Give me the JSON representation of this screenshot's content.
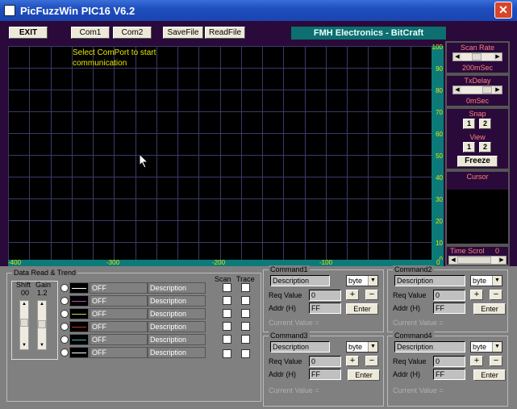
{
  "window": {
    "title": "PicFuzzWin PIC16 V6.2",
    "close": "✕"
  },
  "toolbar": {
    "exit": "EXIT",
    "com1": "Com1",
    "com2": "Com2",
    "savefile": "SaveFile",
    "readfile": "ReadFile",
    "brand": "FMH Electronics - BitCraft"
  },
  "plot": {
    "message_line1": "Select ComPort to start",
    "message_line2": "communication",
    "y_ticks": [
      "100",
      "90",
      "80",
      "70",
      "60",
      "50",
      "40",
      "30",
      "20",
      "10",
      "0"
    ],
    "x_ticks": [
      "-400",
      "-300",
      "-200",
      "-100",
      "0"
    ]
  },
  "right": {
    "scan_rate_label": "Scan Rate",
    "scan_rate_value": "200mSec",
    "txdelay_label": "TxDelay",
    "txdelay_value": "0mSec",
    "snap_label": "Snap",
    "view_label": "View",
    "btn1": "1",
    "btn2": "2",
    "freeze": "Freeze",
    "cursor_label": "Cursor",
    "time_scroll_label": "Time Scrol",
    "time_scroll_value": "0"
  },
  "data_frame": {
    "title": "Data Read & Trend",
    "shift_label": "Shift",
    "gain_label": "Gain",
    "shift_value": "00",
    "gain_value": "1.2",
    "scan_label": "Scan",
    "trace_label": "Trace",
    "channels": [
      {
        "state": "OFF",
        "desc": "Description",
        "color": "#000000"
      },
      {
        "state": "OFF",
        "desc": "Description",
        "color": "#c040c0"
      },
      {
        "state": "OFF",
        "desc": "Description",
        "color": "#d0d060"
      },
      {
        "state": "OFF",
        "desc": "Description",
        "color": "#c03030"
      },
      {
        "state": "OFF",
        "desc": "Description",
        "color": "#40c0c0"
      },
      {
        "state": "OFF",
        "desc": "Description",
        "color": "#ffffff"
      }
    ]
  },
  "commands": [
    {
      "title": "Command1",
      "desc": "Description",
      "type": "byte",
      "req_label": "Req Value",
      "req_value": "0",
      "addr_label": "Addr (H)",
      "addr_value": "FF",
      "enter": "Enter",
      "current": "Current Value ="
    },
    {
      "title": "Command2",
      "desc": "Description",
      "type": "byte",
      "req_label": "Req Value",
      "req_value": "0",
      "addr_label": "Addr (H)",
      "addr_value": "FF",
      "enter": "Enter",
      "current": "Current Value ="
    },
    {
      "title": "Command3",
      "desc": "Description",
      "type": "byte",
      "req_label": "Req Value",
      "req_value": "0",
      "addr_label": "Addr (H)",
      "addr_value": "FF",
      "enter": "Enter",
      "current": "Current Value ="
    },
    {
      "title": "Command4",
      "desc": "Description",
      "type": "byte",
      "req_label": "Req Value",
      "req_value": "0",
      "addr_label": "Addr (H)",
      "addr_value": "FF",
      "enter": "Enter",
      "current": "Current Value ="
    }
  ],
  "colors": {
    "plot_bg": "#000000",
    "grid": "#3a3a6a",
    "axis_bg": "#0d7a7a",
    "axis_text": "#e6e600"
  },
  "icons": {
    "app": "app-icon",
    "close": "close-icon",
    "cursor": "mouse-pointer-icon"
  }
}
